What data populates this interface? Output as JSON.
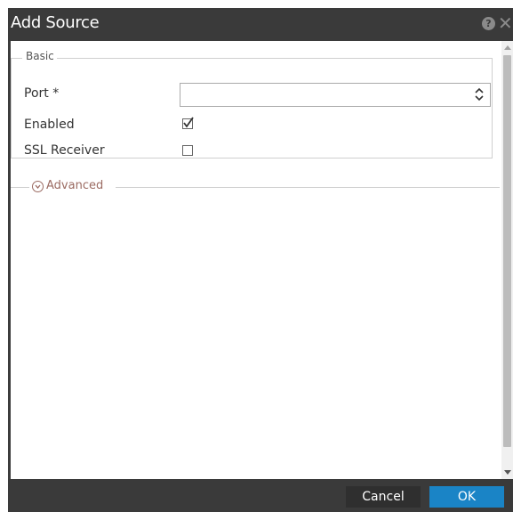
{
  "dialog": {
    "title": "Add Source",
    "help_icon": "question-circle-icon",
    "close_icon": "close-icon"
  },
  "basic": {
    "legend": "Basic",
    "port_label": "Port *",
    "port_value": "",
    "enabled_label": "Enabled",
    "enabled_checked": true,
    "ssl_label": "SSL Receiver",
    "ssl_checked": false
  },
  "advanced": {
    "label": "Advanced",
    "icon": "chevron-down-circle-icon"
  },
  "footer": {
    "cancel_label": "Cancel",
    "ok_label": "OK"
  },
  "colors": {
    "titlebar": "#3a3a3a",
    "ok_button": "#1a84c6",
    "advanced_text": "#9b6b62"
  }
}
